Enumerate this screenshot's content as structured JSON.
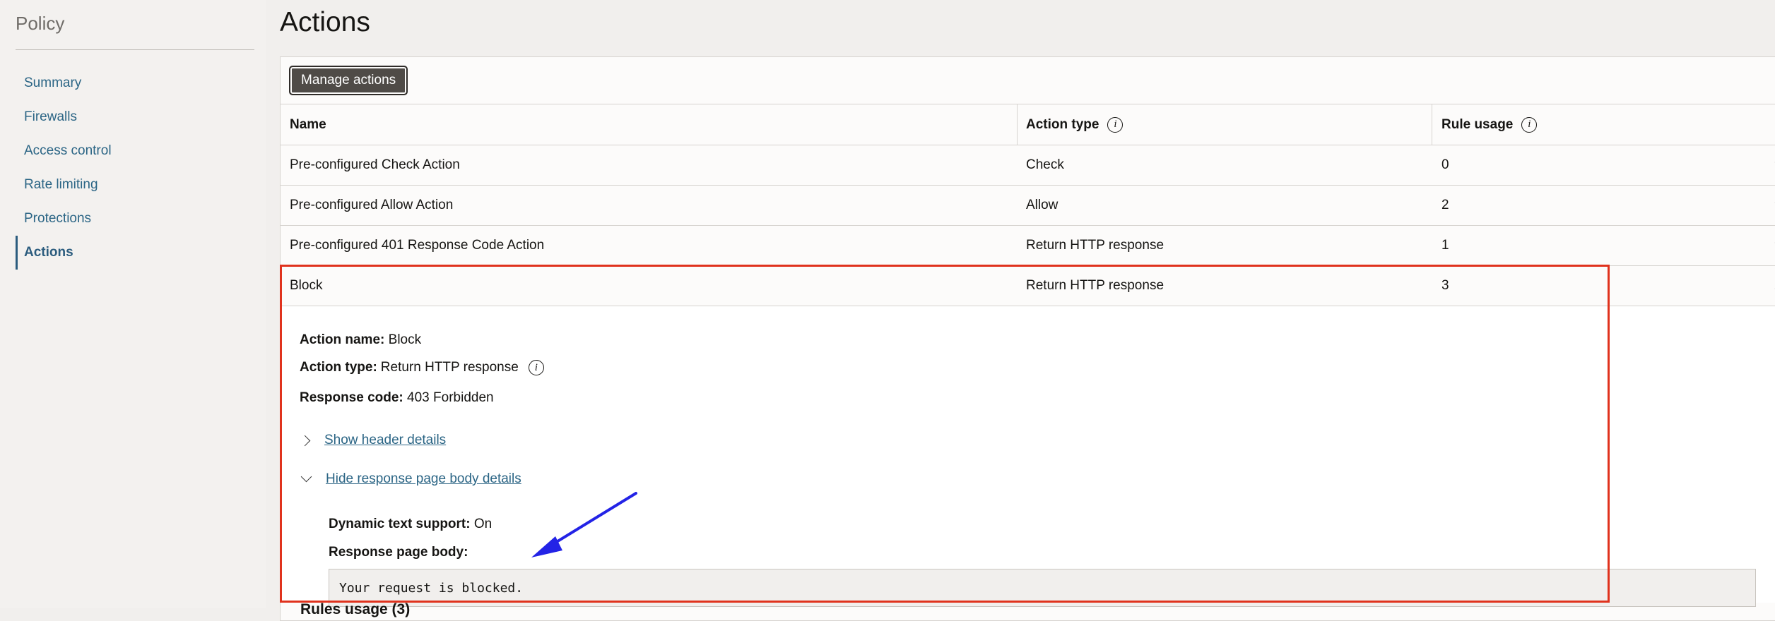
{
  "sidebar": {
    "title": "Policy",
    "items": [
      {
        "label": "Summary"
      },
      {
        "label": "Firewalls"
      },
      {
        "label": "Access control"
      },
      {
        "label": "Rate limiting"
      },
      {
        "label": "Protections"
      },
      {
        "label": "Actions"
      }
    ]
  },
  "page": {
    "title": "Actions"
  },
  "toolbar": {
    "manage_label": "Manage actions"
  },
  "table": {
    "headers": {
      "name": "Name",
      "action_type": "Action type",
      "rule_usage": "Rule usage"
    },
    "info_glyph": "i",
    "rows": [
      {
        "name": "Pre-configured Check Action",
        "type": "Check",
        "usage": "0"
      },
      {
        "name": "Pre-configured Allow Action",
        "type": "Allow",
        "usage": "2"
      },
      {
        "name": "Pre-configured 401 Response Code Action",
        "type": "Return HTTP response",
        "usage": "1"
      },
      {
        "name": "Block",
        "type": "Return HTTP response",
        "usage": "3"
      }
    ]
  },
  "details": {
    "action_name_label": "Action name:",
    "action_name_value": "Block",
    "action_type_label": "Action type:",
    "action_type_value": "Return HTTP response",
    "response_code_label": "Response code:",
    "response_code_value": "403 Forbidden",
    "show_header_link": "Show header details",
    "hide_body_link": "Hide response page body details",
    "dynamic_text_label": "Dynamic text support:",
    "dynamic_text_value": "On",
    "response_body_label": "Response page body:",
    "response_body_value": "Your request is blocked."
  },
  "bottom_peek": "Rules usage (3)",
  "colors": {
    "highlight": "#e0321d",
    "arrow": "#2323e6",
    "accent": "#2b6585",
    "button": "#4f4b47"
  }
}
